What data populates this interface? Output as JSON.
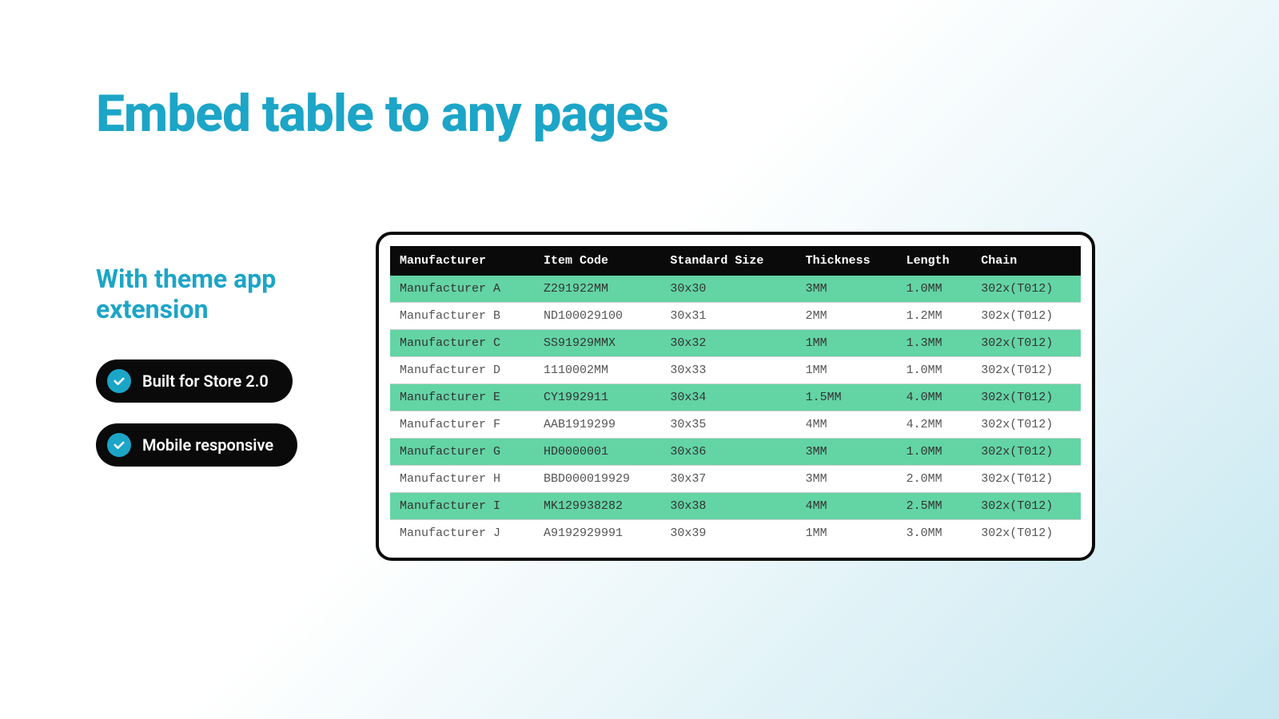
{
  "heading": "Embed table to any pages",
  "subheading": "With theme app extension",
  "features": [
    {
      "label": "Built for Store 2.0"
    },
    {
      "label": "Mobile responsive"
    }
  ],
  "colors": {
    "accent": "#1ca5c7",
    "pill_bg": "#0a0a0a",
    "row_odd": "#63d4a4",
    "row_even": "#ffffff",
    "header_bg": "#0a0a0a"
  },
  "chart_data": {
    "type": "table",
    "columns": [
      "Manufacturer",
      "Item Code",
      "Standard Size",
      "Thickness",
      "Length",
      "Chain"
    ],
    "rows": [
      [
        "Manufacturer A",
        "Z291922MM",
        "30x30",
        "3MM",
        "1.0MM",
        "302x(T012)"
      ],
      [
        "Manufacturer B",
        "ND100029100",
        "30x31",
        "2MM",
        "1.2MM",
        "302x(T012)"
      ],
      [
        "Manufacturer C",
        "SS91929MMX",
        "30x32",
        "1MM",
        "1.3MM",
        "302x(T012)"
      ],
      [
        "Manufacturer D",
        "1110002MM",
        "30x33",
        "1MM",
        "1.0MM",
        "302x(T012)"
      ],
      [
        "Manufacturer E",
        "CY1992911",
        "30x34",
        "1.5MM",
        "4.0MM",
        "302x(T012)"
      ],
      [
        "Manufacturer F",
        "AAB1919299",
        "30x35",
        "4MM",
        "4.2MM",
        "302x(T012)"
      ],
      [
        "Manufacturer G",
        "HD0000001",
        "30x36",
        "3MM",
        "1.0MM",
        "302x(T012)"
      ],
      [
        "Manufacturer H",
        "BBD000019929",
        "30x37",
        "3MM",
        "2.0MM",
        "302x(T012)"
      ],
      [
        "Manufacturer I",
        "MK129938282",
        "30x38",
        "4MM",
        "2.5MM",
        "302x(T012)"
      ],
      [
        "Manufacturer J",
        "A9192929991",
        "30x39",
        "1MM",
        "3.0MM",
        "302x(T012)"
      ]
    ]
  }
}
